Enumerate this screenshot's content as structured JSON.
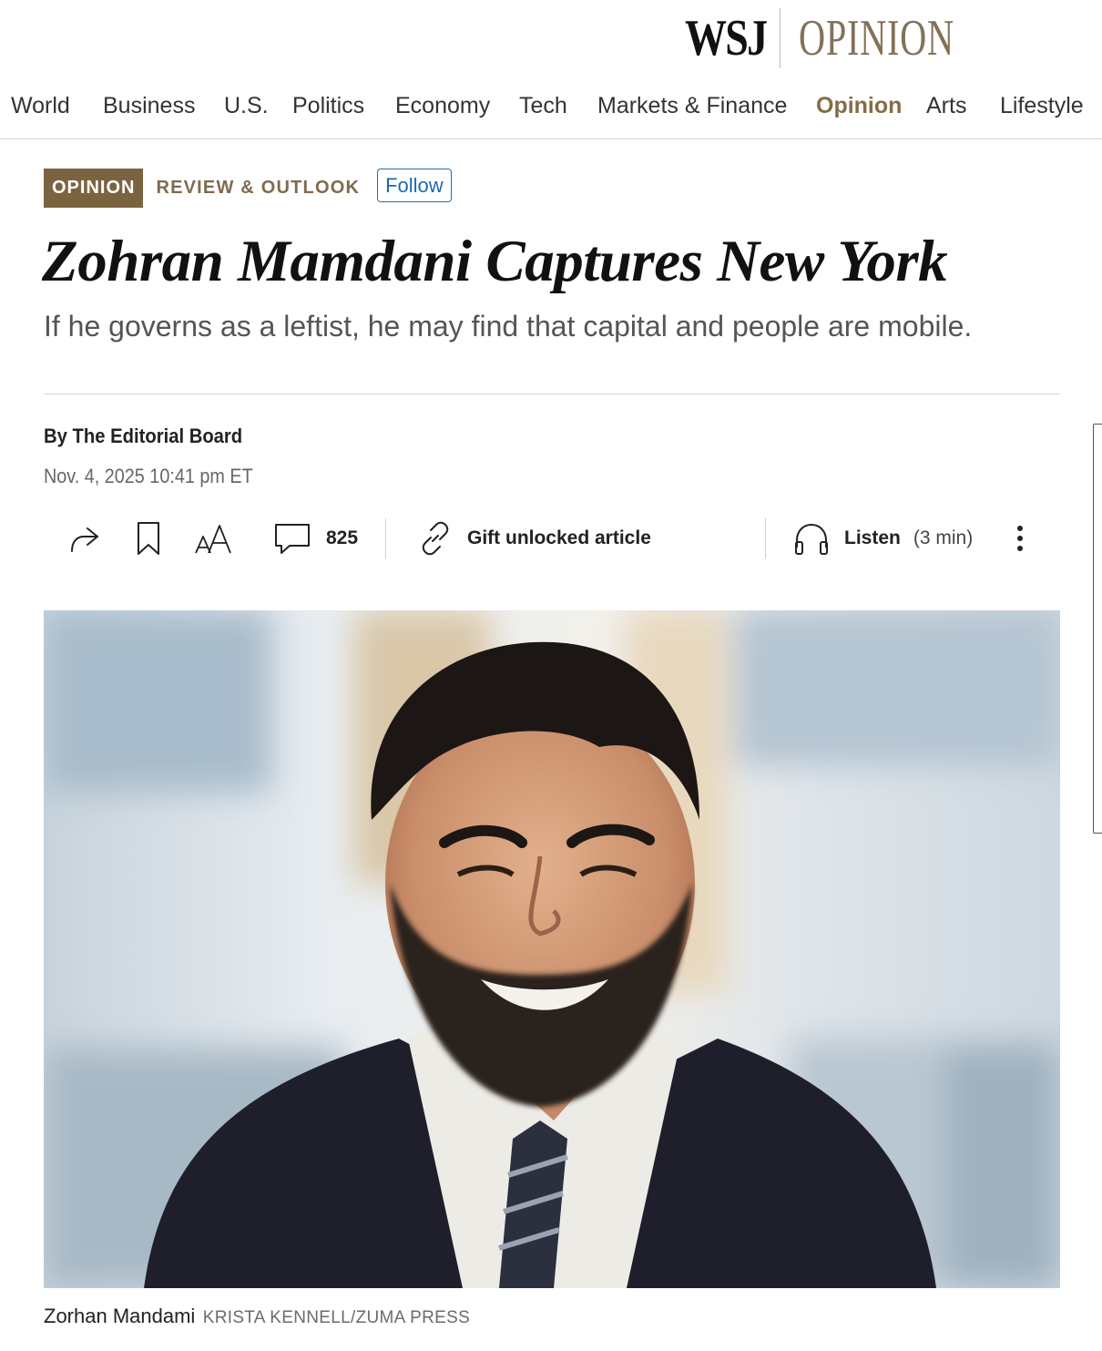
{
  "brand": {
    "wsj": "WSJ",
    "section": "OPINION",
    "accent_color": "#866b47"
  },
  "nav": {
    "items": [
      "World",
      "Business",
      "U.S.",
      "Politics",
      "Economy",
      "Tech",
      "Markets & Finance",
      "Opinion",
      "Arts",
      "Lifestyle"
    ],
    "active": "Opinion"
  },
  "flashline": {
    "badge": "OPINION",
    "section": "REVIEW & OUTLOOK",
    "follow_label": "Follow"
  },
  "article": {
    "headline": "Zohran Mamdani Captures New York",
    "dek": "If he governs as a leftist, he may find that capital and people are mobile.",
    "byline": "By The Editorial Board",
    "timestamp": "Nov. 4, 2025 10:41 pm ET"
  },
  "toolbar": {
    "icons": [
      "share-icon",
      "bookmark-icon",
      "text-size-icon",
      "comment-icon",
      "gift-link-icon",
      "headphones-icon",
      "more-vertical-icon"
    ],
    "comment_count": "825",
    "gift_label": "Gift unlocked article",
    "listen_label": "Listen",
    "listen_duration": "(3 min)"
  },
  "photo": {
    "caption": "Zorhan Mandami",
    "credit": "KRISTA KENNELL/ZUMA PRESS"
  }
}
